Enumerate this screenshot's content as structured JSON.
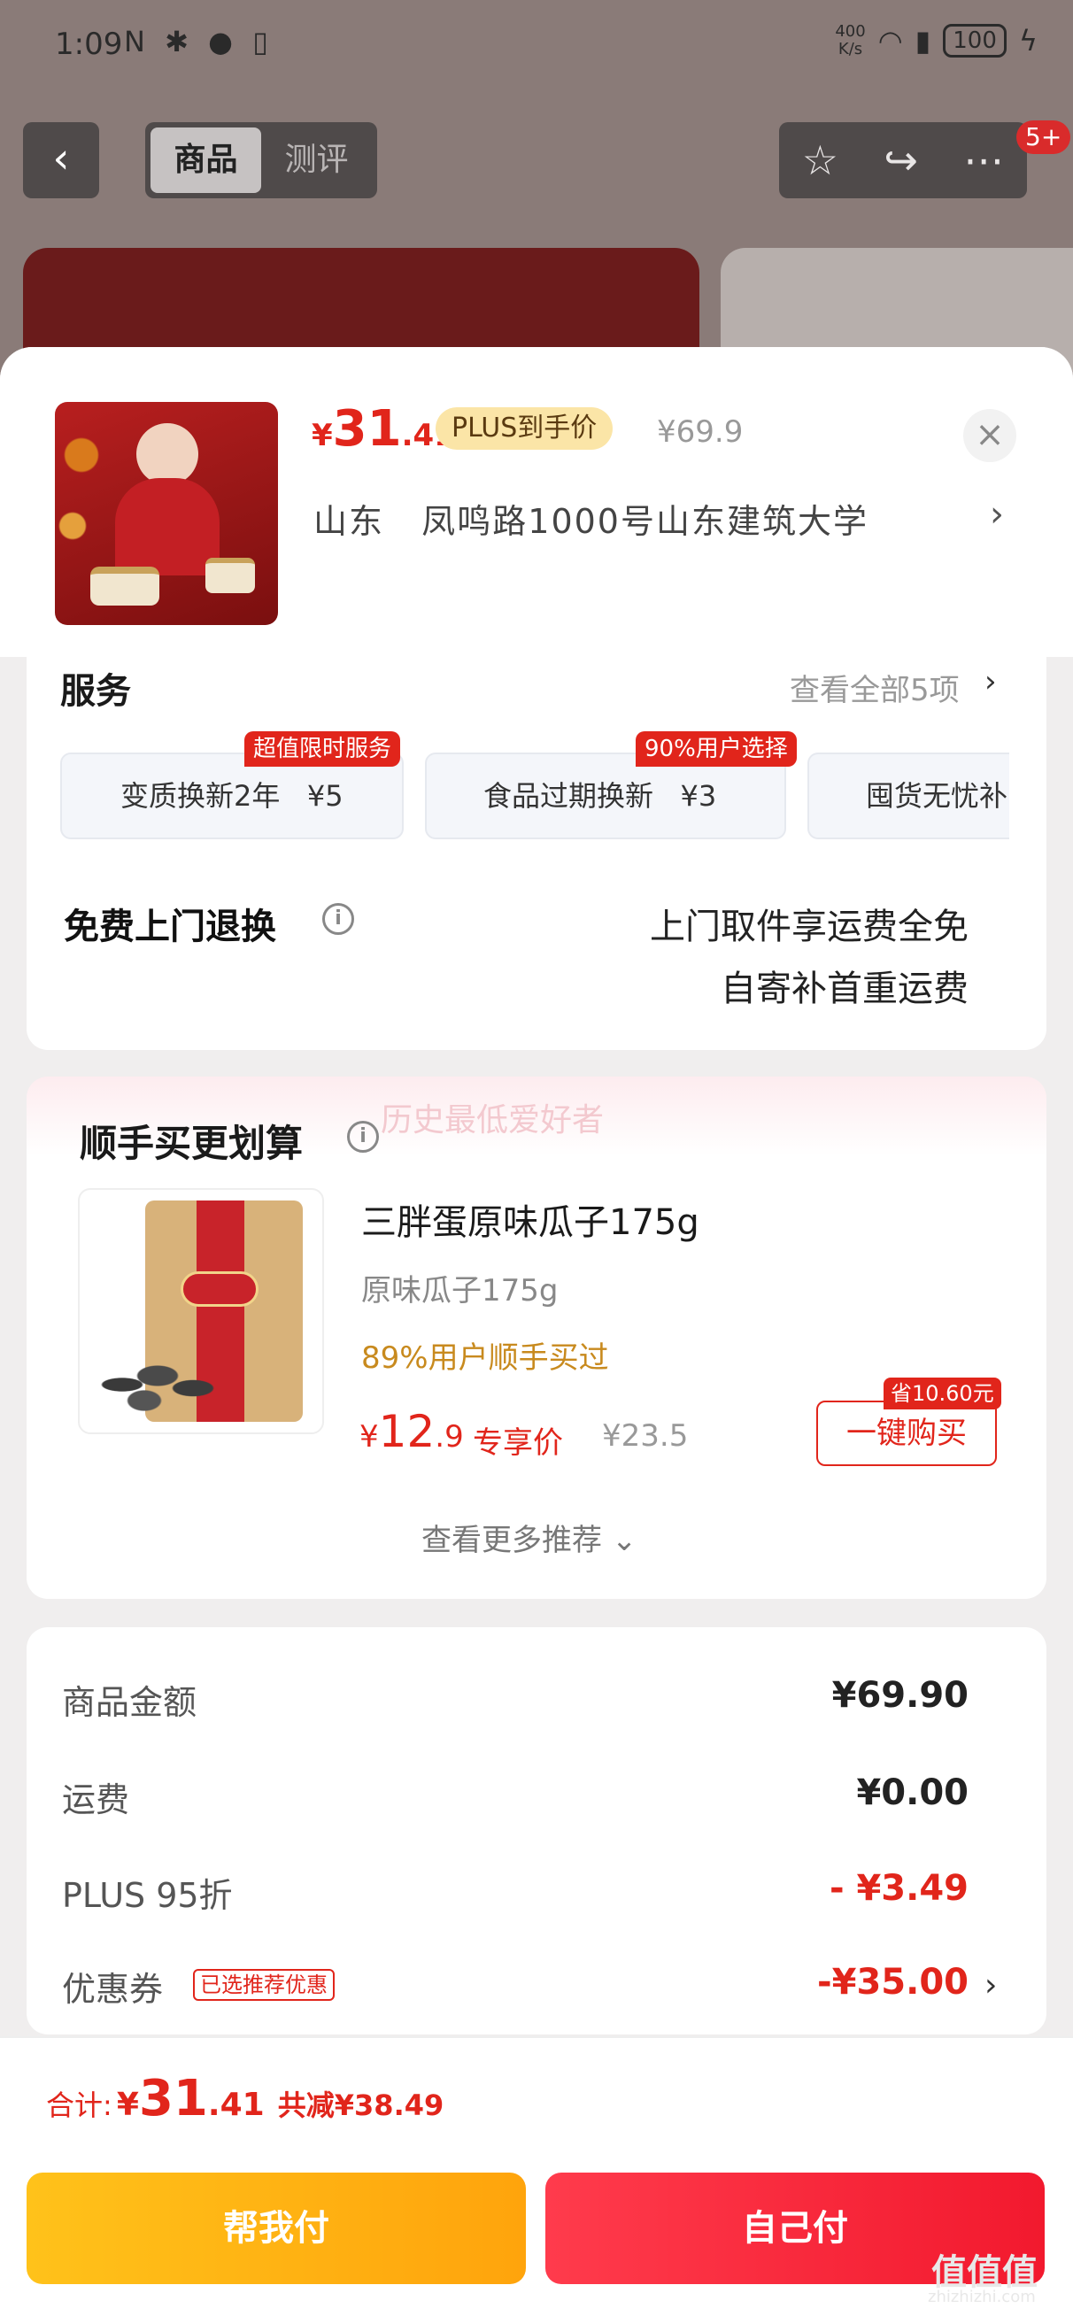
{
  "status_bar": {
    "time": "1:09",
    "net_speed_value": "400",
    "net_speed_unit": "K/s",
    "battery": "100"
  },
  "top_nav": {
    "tabs": [
      {
        "label": "商品",
        "active": true
      },
      {
        "label": "测评",
        "active": false
      }
    ],
    "badge": "5+"
  },
  "product": {
    "price_currency": "¥",
    "price_int": "31",
    "price_dec": ".41",
    "plus_tag": "PLUS到手价",
    "original_price": "¥69.9",
    "address_province": "山东",
    "address_detail": "凤鸣路1000号山东建筑大学"
  },
  "services": {
    "title": "服务",
    "view_all": "查看全部5项",
    "items": [
      {
        "label": "变质换新2年",
        "price": "¥5",
        "tag": "超值限时服务"
      },
      {
        "label": "食品过期换新",
        "price": "¥3",
        "tag": "90%用户选择"
      },
      {
        "label": "囤货无忧补",
        "price": "",
        "tag": ""
      }
    ],
    "free_return_title": "免费上门退换",
    "free_return_line1": "上门取件享运费全免",
    "free_return_line2": "自寄补首重运费"
  },
  "bundle": {
    "title": "顺手买更划算",
    "watermark": "历史最低爱好者",
    "product_name": "三胖蛋原味瓜子175g",
    "spec": "原味瓜子175g",
    "users_pct": "89%用户顺手买过",
    "price_currency": "¥",
    "price_int": "12",
    "price_dec": ".9",
    "exclusive_label": "专享价",
    "original_price": "¥23.5",
    "save_tag": "省10.60元",
    "buy_button": "一键购买",
    "more_recommend": "查看更多推荐"
  },
  "summary": {
    "rows": [
      {
        "label": "商品金额",
        "value": "¥69.90"
      },
      {
        "label": "运费",
        "value": "¥0.00"
      },
      {
        "label": "PLUS 95折",
        "value": "- ¥3.49"
      },
      {
        "label": "优惠券",
        "value": "-¥35.00",
        "tag": "已选推荐优惠"
      }
    ]
  },
  "bottom": {
    "total_label": "合计:",
    "total_currency": "¥",
    "total_int": "31",
    "total_dec": ".41",
    "total_saved": "共减¥38.49",
    "help_pay": "帮我付",
    "self_pay": "自己付",
    "watermark_logo": "值值值",
    "watermark_url": "zhizhizhi.com"
  },
  "colors": {
    "accent_red": "#e1251b",
    "plus_gold": "#fbe5a7",
    "help_btn": "#ffb313",
    "self_btn": "#f5263b"
  }
}
